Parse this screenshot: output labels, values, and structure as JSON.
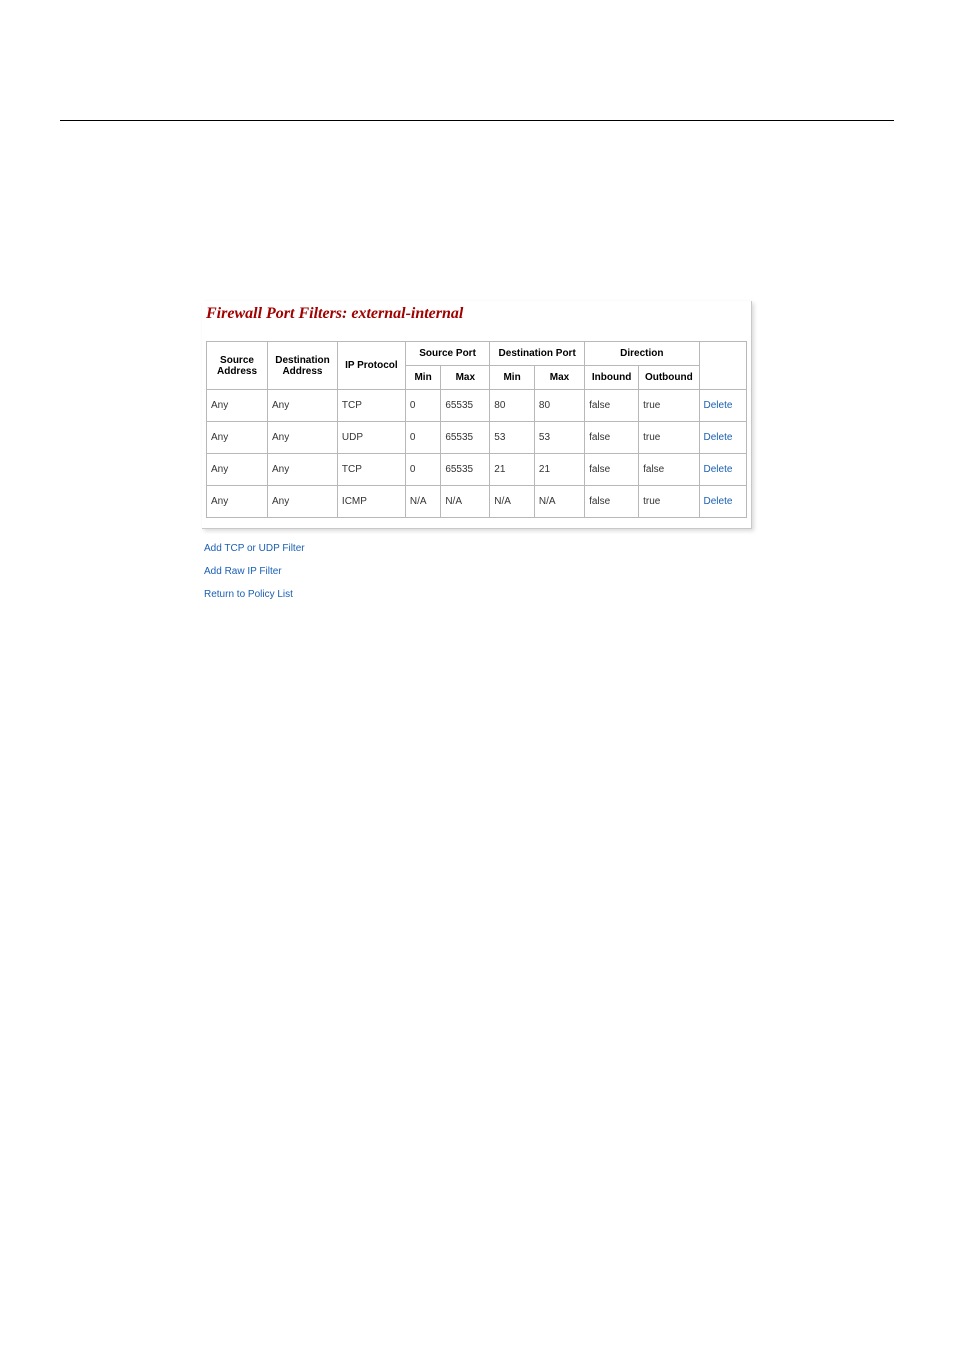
{
  "title": "Firewall Port Filters: external-internal",
  "headers": {
    "source_address": "Source Address",
    "destination_address": "Destination Address",
    "ip_protocol": "IP Protocol",
    "source_port": "Source Port",
    "destination_port": "Destination Port",
    "direction": "Direction",
    "min": "Min",
    "max": "Max",
    "inbound": "Inbound",
    "outbound": "Outbound"
  },
  "rows": [
    {
      "source": "Any",
      "dest": "Any",
      "proto": "TCP",
      "smin": "0",
      "smax": "65535",
      "dmin": "80",
      "dmax": "80",
      "inbound": "false",
      "outbound": "true",
      "action": "Delete"
    },
    {
      "source": "Any",
      "dest": "Any",
      "proto": "UDP",
      "smin": "0",
      "smax": "65535",
      "dmin": "53",
      "dmax": "53",
      "inbound": "false",
      "outbound": "true",
      "action": "Delete"
    },
    {
      "source": "Any",
      "dest": "Any",
      "proto": "TCP",
      "smin": "0",
      "smax": "65535",
      "dmin": "21",
      "dmax": "21",
      "inbound": "false",
      "outbound": "false",
      "action": "Delete"
    },
    {
      "source": "Any",
      "dest": "Any",
      "proto": "ICMP",
      "smin": "N/A",
      "smax": "N/A",
      "dmin": "N/A",
      "dmax": "N/A",
      "inbound": "false",
      "outbound": "true",
      "action": "Delete"
    }
  ],
  "links": {
    "add_tcp_udp": "Add TCP or UDP Filter",
    "add_raw_ip": "Add Raw IP Filter",
    "return": "Return to Policy List"
  }
}
